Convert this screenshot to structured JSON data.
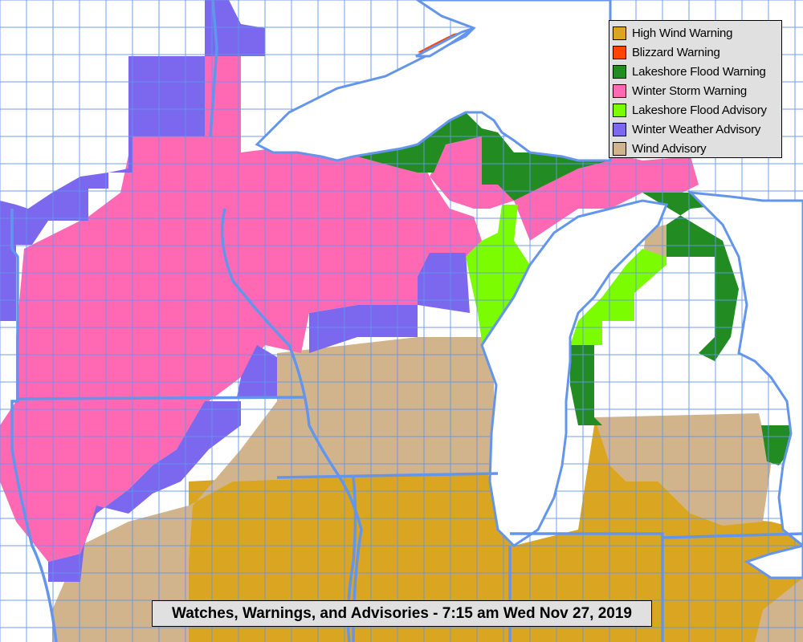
{
  "map": {
    "title": "Watches, Warnings, and Advisories - 7:15 am Wed Nov 27, 2019",
    "background_color": "#ffffff",
    "boundary_color": "#6495ed"
  },
  "legend": {
    "items": [
      {
        "label": "High Wind Warning",
        "color": "#daa520"
      },
      {
        "label": "Blizzard Warning",
        "color": "#ff4500"
      },
      {
        "label": "Lakeshore Flood Warning",
        "color": "#228b22"
      },
      {
        "label": "Winter Storm Warning",
        "color": "#ff69b4"
      },
      {
        "label": "Lakeshore Flood Advisory",
        "color": "#7cfc00"
      },
      {
        "label": "Winter Weather Advisory",
        "color": "#7b68ee"
      },
      {
        "label": "Wind Advisory",
        "color": "#d2b48c"
      }
    ]
  }
}
